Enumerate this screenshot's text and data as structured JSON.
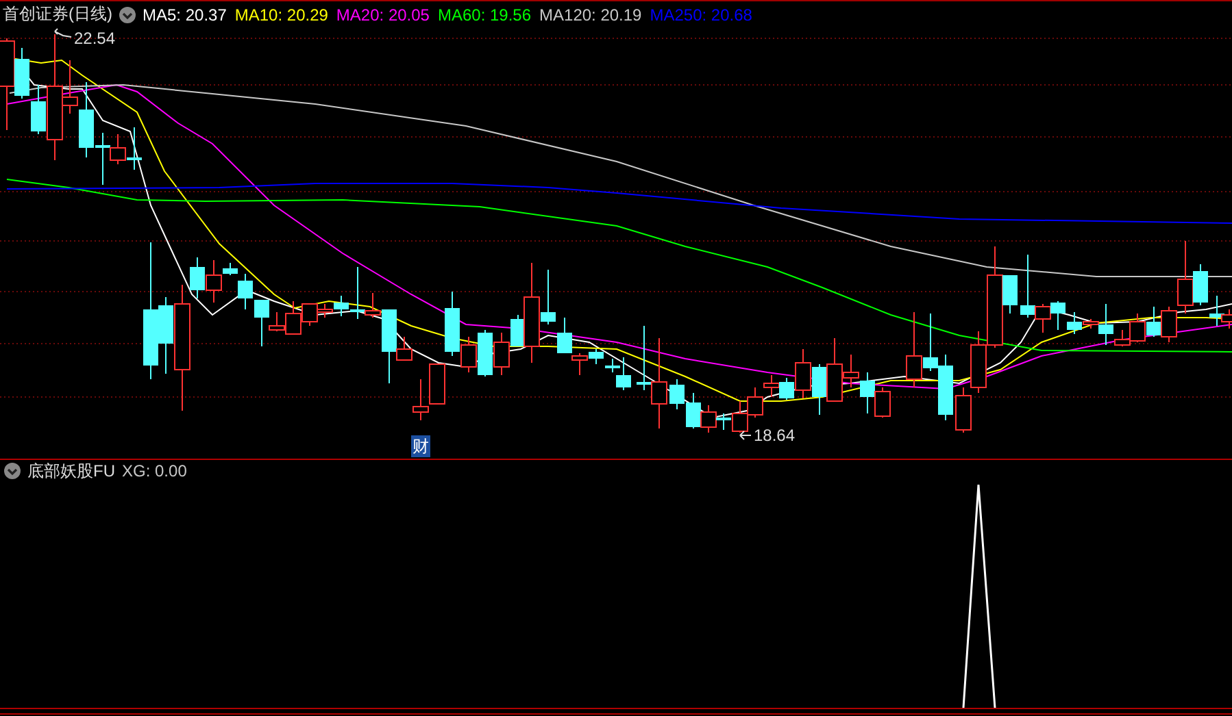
{
  "main_panel": {
    "title": "首创证券(日线)",
    "indicators": [
      {
        "label": "MA5: 20.37",
        "color": "#ffffff"
      },
      {
        "label": "MA10: 20.29",
        "color": "#ffff00"
      },
      {
        "label": "MA20: 20.05",
        "color": "#ff00ff"
      },
      {
        "label": "MA60: 19.56",
        "color": "#00ff00"
      },
      {
        "label": "MA120: 20.19",
        "color": "#c8c8c8"
      },
      {
        "label": "MA250: 20.68",
        "color": "#0000ff"
      }
    ],
    "annotations": [
      {
        "kind": "high",
        "text": "22.54"
      },
      {
        "kind": "low",
        "text": "18.64"
      },
      {
        "kind": "badge",
        "text": "财"
      }
    ]
  },
  "sub_panel": {
    "title": "底部妖股FU",
    "indicators": [
      {
        "label": "XG: 0.00",
        "color": "#c8c8c8"
      }
    ]
  }
}
